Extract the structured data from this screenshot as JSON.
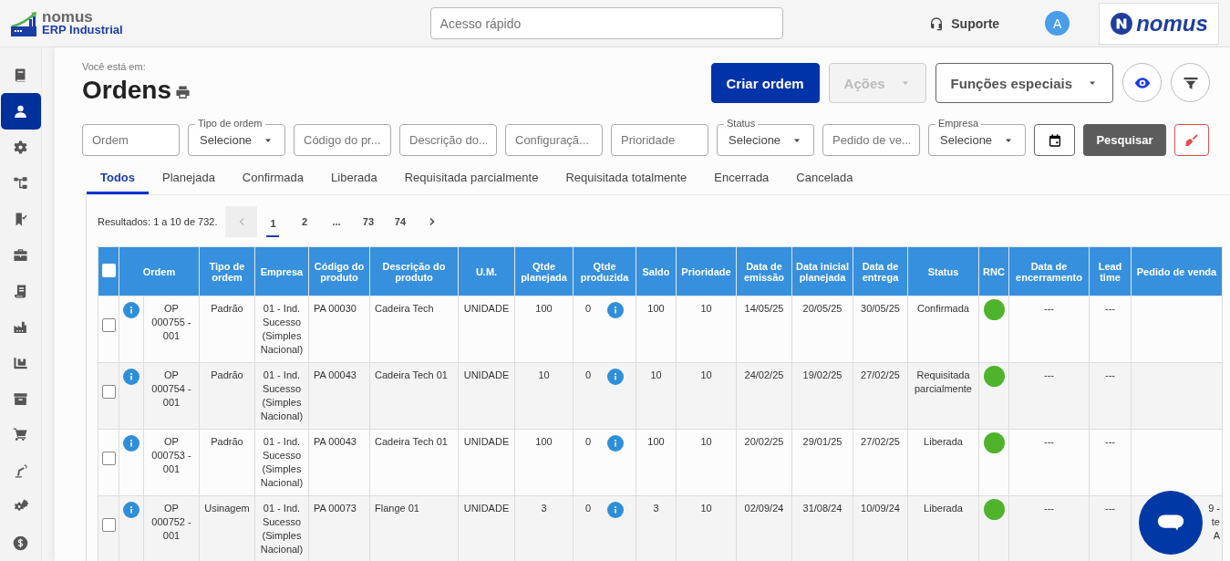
{
  "header": {
    "logo": {
      "brand": "nomus",
      "product": "ERP Industrial"
    },
    "quick_access": {
      "placeholder": "Acesso rápido"
    },
    "support": "Suporte",
    "avatar": "A",
    "partner_logo": "nomus"
  },
  "sidebar": {
    "items": [
      {
        "selected": false
      },
      {
        "selected": true
      },
      {
        "selected": false
      },
      {
        "selected": false
      },
      {
        "selected": false
      },
      {
        "selected": false
      },
      {
        "selected": false
      },
      {
        "selected": false
      },
      {
        "selected": false
      },
      {
        "selected": false
      },
      {
        "selected": false
      },
      {
        "selected": false
      },
      {
        "selected": false
      },
      {
        "selected": false
      }
    ]
  },
  "page": {
    "breadcrumb": "Você está em:",
    "title": "Ordens"
  },
  "actions": [
    {
      "kind": "primary",
      "label": "Criar ordem",
      "disabled": false
    },
    {
      "kind": "dropdown",
      "label": "Ações",
      "disabled": true
    },
    {
      "kind": "dropdown",
      "label": "Funções especiais",
      "disabled": false
    },
    {
      "kind": "eye"
    },
    {
      "kind": "filter"
    }
  ],
  "filters": [
    {
      "kind": "text",
      "placeholder": "Ordem"
    },
    {
      "kind": "select",
      "label": "Tipo de ordem",
      "value": "Selecione"
    },
    {
      "kind": "text",
      "placeholder": "Código do pr..."
    },
    {
      "kind": "text",
      "placeholder": "Descrição do..."
    },
    {
      "kind": "text",
      "placeholder": "Configuraçã..."
    },
    {
      "kind": "text",
      "placeholder": "Prioridade"
    },
    {
      "kind": "select",
      "label": "Status",
      "value": "Selecione"
    },
    {
      "kind": "text",
      "placeholder": "Pedido de ve..."
    },
    {
      "kind": "select",
      "label": "Empresa",
      "value": "Selecione"
    },
    {
      "kind": "calendar"
    },
    {
      "kind": "search",
      "label": "Pesquisar"
    },
    {
      "kind": "clear"
    }
  ],
  "tabs": [
    {
      "label": "Todos",
      "selected": true
    },
    {
      "label": "Planejada",
      "selected": false
    },
    {
      "label": "Confirmada",
      "selected": false
    },
    {
      "label": "Liberada",
      "selected": false
    },
    {
      "label": "Requisitada parcialmente",
      "selected": false
    },
    {
      "label": "Requisitada totalmente",
      "selected": false
    },
    {
      "label": "Encerrada",
      "selected": false
    },
    {
      "label": "Cancelada",
      "selected": false
    }
  ],
  "pagination": {
    "results": "Resultados: 1 a 10 de 732.",
    "prev_disabled": true,
    "pages": [
      {
        "label": "1",
        "selected": true
      },
      {
        "label": "2",
        "selected": false
      },
      {
        "label": "...",
        "selected": false
      },
      {
        "label": "73",
        "selected": false
      },
      {
        "label": "74",
        "selected": false
      }
    ]
  },
  "table": {
    "select_all_checked": false,
    "columns": [
      "Ordem",
      "Tipo de ordem",
      "Empresa",
      "Código do produto",
      "Descrição do produto",
      "U.M.",
      "Qtde planejada",
      "Qtde produzida",
      "Saldo",
      "Prioridade",
      "Data de emissão",
      "Data inicial planejada",
      "Data de entrega",
      "Status",
      "RNC",
      "Data de encerramento",
      "Lead time",
      "Pedido de venda"
    ],
    "rows": [
      {
        "checked": false,
        "ordem": "OP 000755 - 001",
        "tipo": "Padrão",
        "empresa": "01 - Ind. Sucesso (Simples Nacional)",
        "codigo": "PA 00030",
        "descricao": "Cadeira Tech",
        "um": "UNIDADE",
        "qtde_planejada": "100",
        "qtde_produzida": "0",
        "saldo": "100",
        "prioridade": "10",
        "data_emissao": "14/05/25",
        "data_inicial": "20/05/25",
        "data_entrega": "30/05/25",
        "status": "Confirmada",
        "rnc": {
          "color": "#4fb32c"
        },
        "data_encerramento": "---",
        "lead_time": "---",
        "pedido_venda": []
      },
      {
        "checked": false,
        "ordem": "OP 000754 - 001",
        "tipo": "Padrão",
        "empresa": "01 - Ind. Sucesso (Simples Nacional)",
        "codigo": "PA 00043",
        "descricao": "Cadeira Tech 01",
        "um": "UNIDADE",
        "qtde_planejada": "10",
        "qtde_produzida": "0",
        "saldo": "10",
        "prioridade": "10",
        "data_emissao": "24/02/25",
        "data_inicial": "19/02/25",
        "data_entrega": "27/02/25",
        "status": "Requisitada parcialmente",
        "rnc": {
          "color": "#4fb32c"
        },
        "data_encerramento": "---",
        "lead_time": "---",
        "pedido_venda": []
      },
      {
        "checked": false,
        "ordem": "OP 000753 - 001",
        "tipo": "Padrão",
        "empresa": "01 - Ind. Sucesso (Simples Nacional)",
        "codigo": "PA 00043",
        "descricao": "Cadeira Tech 01",
        "um": "UNIDADE",
        "qtde_planejada": "100",
        "qtde_produzida": "0",
        "saldo": "100",
        "prioridade": "10",
        "data_emissao": "20/02/25",
        "data_inicial": "29/01/25",
        "data_entrega": "27/02/25",
        "status": "Liberada",
        "rnc": {
          "color": "#4fb32c"
        },
        "data_encerramento": "---",
        "lead_time": "---",
        "pedido_venda": []
      },
      {
        "checked": false,
        "ordem": "OP 000752 - 001",
        "tipo": "Usinagem",
        "empresa": "01 - Ind. Sucesso (Simples Nacional)",
        "codigo": "PA 00073",
        "descricao": "Flange 01",
        "um": "UNIDADE",
        "qtde_planejada": "3",
        "qtde_produzida": "0",
        "saldo": "3",
        "prioridade": "10",
        "data_emissao": "02/09/24",
        "data_inicial": "31/08/24",
        "data_entrega": "10/09/24",
        "status": "Liberada",
        "rnc": {
          "color": "#4fb32c"
        },
        "data_encerramento": "---",
        "lead_time": "---",
        "pedido_venda": [
          "9 -",
          "te",
          "A"
        ]
      }
    ]
  }
}
